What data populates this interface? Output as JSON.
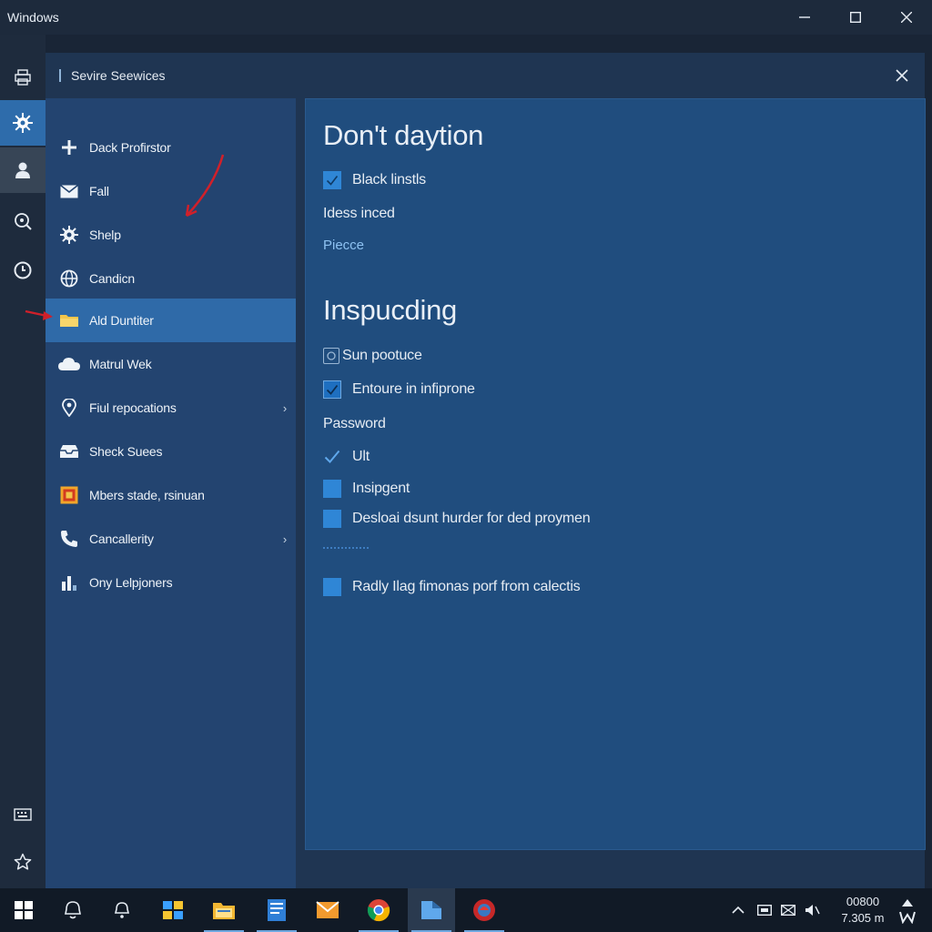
{
  "window": {
    "title": "Windows",
    "minimize_icon": "minimize-icon",
    "maximize_icon": "maximize-icon",
    "close_icon": "close-icon"
  },
  "rail": {
    "items": [
      {
        "icon": "printer-icon"
      },
      {
        "icon": "gear-icon",
        "active": true
      },
      {
        "icon": "person-icon"
      },
      {
        "icon": "search-icon"
      },
      {
        "icon": "clock-icon"
      },
      {
        "icon": "keyboard-icon"
      },
      {
        "icon": "star-icon"
      }
    ]
  },
  "dialog": {
    "title": "Sevire Seewices",
    "close_icon": "close-icon"
  },
  "nav": {
    "items": [
      {
        "label": "Dack Profirstor",
        "icon": "plus-icon"
      },
      {
        "label": "Fall",
        "icon": "mail-icon"
      },
      {
        "label": "Shelp",
        "icon": "gear-icon"
      },
      {
        "label": "Candicn",
        "icon": "globe-icon"
      },
      {
        "label": "Ald Duntiter",
        "icon": "folder-icon",
        "selected": true
      },
      {
        "label": "Matrul Wek",
        "icon": "cloud-icon"
      },
      {
        "label": "Fiul repocations",
        "icon": "location-pin-icon",
        "chevron": "›"
      },
      {
        "label": "Sheck Suees",
        "icon": "inbox-icon"
      },
      {
        "label": "Mbers stade, rsinuan",
        "icon": "image-icon"
      },
      {
        "label": "Cancallerity",
        "icon": "phone-icon",
        "chevron": "›"
      },
      {
        "label": "Ony Lelpjoners",
        "icon": "bar-chart-icon"
      }
    ]
  },
  "content": {
    "section1": {
      "heading": "Don't daytion",
      "black_lists_label": "Black linstls",
      "black_lists_checked": true,
      "ideas_text": "Idess inced",
      "link_text": "Piecce"
    },
    "section2": {
      "heading": "Inspucding",
      "sun_label": "Sun pootuce",
      "entour_label": "Entoure in infiprone",
      "entour_checked": true,
      "password_label": "Password",
      "ult_label": "Ult",
      "ult_checked": true,
      "insipgent_label": "Insipgent",
      "deslodi_label": "Desloai dsunt hurder for ded proymen",
      "radly_label": "Radly Ilag fimonas porf from calectis"
    }
  },
  "taskbar": {
    "start_icon": "windows-start-icon",
    "apps": [
      {
        "icon": "search-icon"
      },
      {
        "icon": "cortana-icon"
      },
      {
        "icon": "photos-icon"
      },
      {
        "icon": "file-explorer-icon",
        "running": true
      },
      {
        "icon": "document-icon",
        "running": true
      },
      {
        "icon": "mail-icon"
      },
      {
        "icon": "chrome-icon",
        "running": true
      },
      {
        "icon": "store-icon",
        "active": true
      },
      {
        "icon": "browser-icon",
        "running": true
      }
    ],
    "tray": {
      "chevron_icon": "chevron-up-icon",
      "network_icon": "network-icon",
      "mail_icon": "mail-icon",
      "volume_icon": "volume-icon",
      "clock_top": "00800",
      "clock_bottom": "7.305 m",
      "notification_icon": "notification-icon"
    }
  },
  "colors": {
    "accent": "#2f6aa8",
    "checkbox": "#2f86d6",
    "annotation": "#d0202a"
  }
}
